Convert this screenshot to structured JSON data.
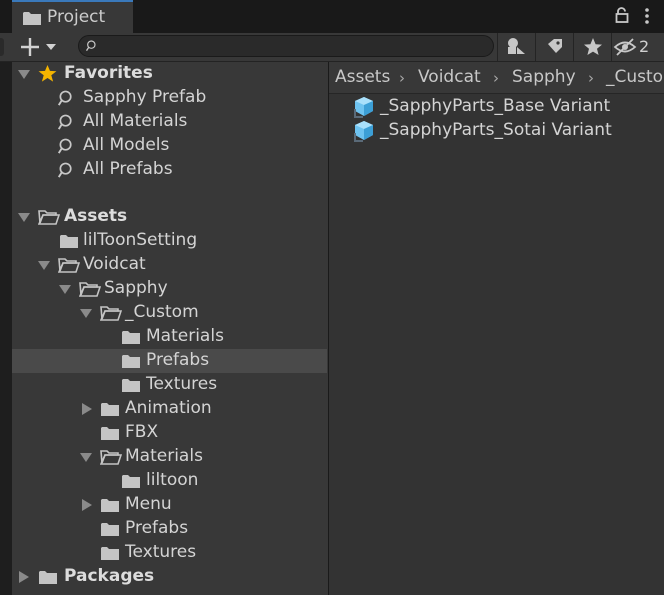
{
  "window": {
    "tab_title": "Project",
    "tab_icon": "folder-icon"
  },
  "toolbar": {
    "add_icon": "plus-icon",
    "dropdown_icon": "caret-down-icon",
    "search": {
      "value": "",
      "placeholder": ""
    },
    "filter_buttons": [
      "search-by-type-icon",
      "search-by-label-icon",
      "favorite-star-icon",
      "hidden-packages-icon"
    ],
    "hidden_packages_count": "2"
  },
  "breadcrumb": [
    "Assets",
    "Voidcat",
    "Sapphy",
    "_Custom"
  ],
  "tree": {
    "favorites": {
      "label": "Favorites",
      "items": [
        "Sapphy Prefab",
        "All Materials",
        "All Models",
        "All Prefabs"
      ]
    },
    "assets": {
      "label": "Assets",
      "liltoon_setting": "lilToonSetting",
      "voidcat": "Voidcat",
      "sapphy": "Sapphy",
      "custom": "_Custom",
      "custom_materials": "Materials",
      "custom_prefabs": "Prefabs",
      "custom_textures": "Textures",
      "animation": "Animation",
      "fbx": "FBX",
      "materials": "Materials",
      "liltoon": "liltoon",
      "menu": "Menu",
      "prefabs": "Prefabs",
      "textures": "Textures"
    },
    "packages": {
      "label": "Packages"
    },
    "selected_item": "Prefabs"
  },
  "files": [
    {
      "name": "_SapphyParts_Base Variant",
      "icon": "prefab-variant-icon"
    },
    {
      "name": "_SapphyParts_Sotai Variant",
      "icon": "prefab-variant-icon"
    }
  ],
  "colors": {
    "accent": "#3a79bb",
    "panel": "#383838",
    "selection": "#4a4a4a",
    "star": "#f4b400",
    "prefab": "#4fb0e8"
  }
}
